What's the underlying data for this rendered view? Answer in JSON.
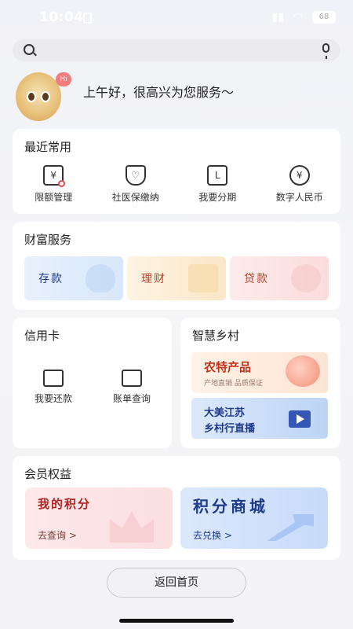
{
  "status": {
    "time": "10:04",
    "battery": "68"
  },
  "greeting": {
    "badge": "Hi",
    "text": "上午好，很高兴为您服务～"
  },
  "recent": {
    "title": "最近常用",
    "items": [
      {
        "label": "限额管理",
        "icon": "limit-management-icon"
      },
      {
        "label": "社医保缴纳",
        "icon": "social-insurance-icon"
      },
      {
        "label": "我要分期",
        "icon": "installment-calendar-icon"
      },
      {
        "label": "数字人民币",
        "icon": "digital-rmb-icon"
      }
    ]
  },
  "wealth": {
    "title": "财富服务",
    "deposit": "存款",
    "finance": "理财",
    "loan": "贷款"
  },
  "credit": {
    "title": "信用卡",
    "repay": "我要还款",
    "bill": "账单查询"
  },
  "rural": {
    "title": "智慧乡村",
    "b1_title": "农特产品",
    "b1_sub": "产地直销 品质保证",
    "b2_line1": "大美江苏",
    "b2_line2": "乡村行直播"
  },
  "member": {
    "title": "会员权益",
    "points_title": "我的积分",
    "points_link": "去查询 >",
    "mall_title": "积分商城",
    "mall_link": "去兑换 >"
  },
  "footer": {
    "home_button": "返回首页"
  }
}
